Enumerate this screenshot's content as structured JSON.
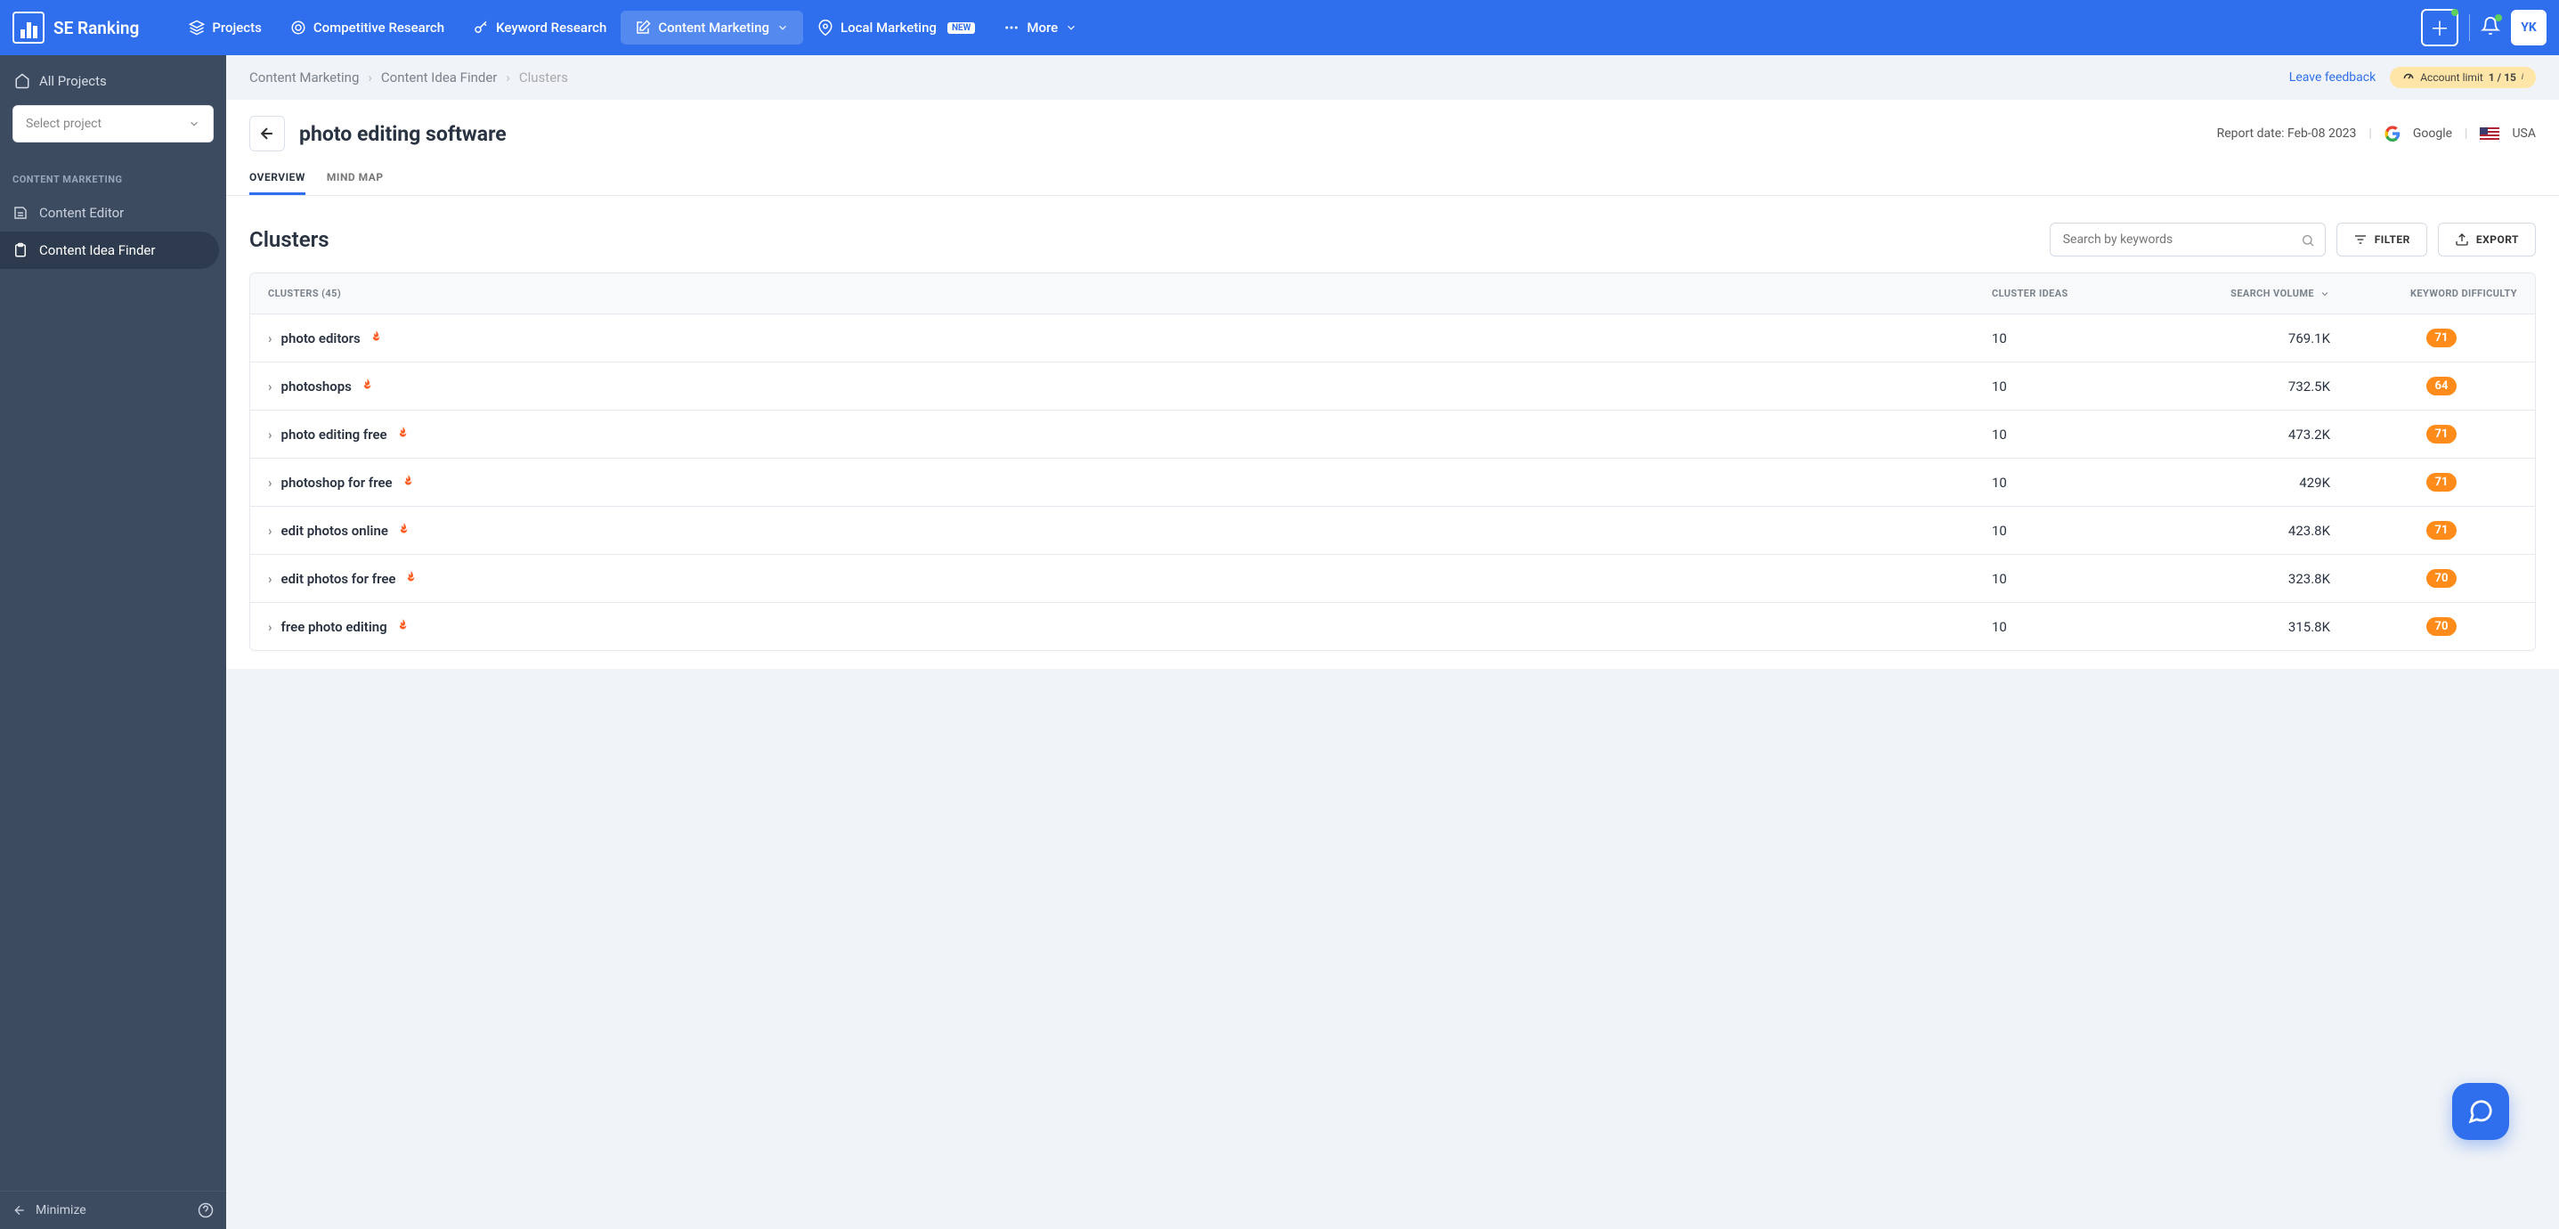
{
  "brand": "SE Ranking",
  "nav": {
    "projects": "Projects",
    "competitive": "Competitive Research",
    "keyword": "Keyword Research",
    "content": "Content Marketing",
    "local": "Local Marketing",
    "new_badge": "NEW",
    "more": "More"
  },
  "avatar": "YK",
  "sidebar": {
    "all_projects": "All Projects",
    "select_project": "Select project",
    "section_title": "CONTENT MARKETING",
    "content_editor": "Content Editor",
    "content_idea": "Content Idea Finder",
    "minimize": "Minimize"
  },
  "crumbs": {
    "a": "Content Marketing",
    "b": "Content Idea Finder",
    "c": "Clusters"
  },
  "leave_feedback": "Leave feedback",
  "account_limit_label": "Account limit",
  "account_limit_value": "1 / 15",
  "page_title": "photo editing software",
  "report": {
    "date_label": "Report date: Feb-08 2023",
    "engine": "Google",
    "country": "USA"
  },
  "tabs": {
    "overview": "OVERVIEW",
    "mindmap": "MIND MAP"
  },
  "clusters_heading": "Clusters",
  "search_placeholder": "Search by keywords",
  "filter_label": "FILTER",
  "export_label": "EXPORT",
  "columns": {
    "clusters": "CLUSTERS  (45)",
    "ideas": "CLUSTER IDEAS",
    "vol": "SEARCH VOLUME",
    "diff": "KEYWORD DIFFICULTY"
  },
  "rows": [
    {
      "name": "photo editors",
      "ideas": "10",
      "vol": "769.1K",
      "diff": "71"
    },
    {
      "name": "photoshops",
      "ideas": "10",
      "vol": "732.5K",
      "diff": "64"
    },
    {
      "name": "photo editing free",
      "ideas": "10",
      "vol": "473.2K",
      "diff": "71"
    },
    {
      "name": "photoshop for free",
      "ideas": "10",
      "vol": "429K",
      "diff": "71"
    },
    {
      "name": "edit photos online",
      "ideas": "10",
      "vol": "423.8K",
      "diff": "71"
    },
    {
      "name": "edit photos for free",
      "ideas": "10",
      "vol": "323.8K",
      "diff": "70"
    },
    {
      "name": "free photo editing",
      "ideas": "10",
      "vol": "315.8K",
      "diff": "70"
    }
  ]
}
